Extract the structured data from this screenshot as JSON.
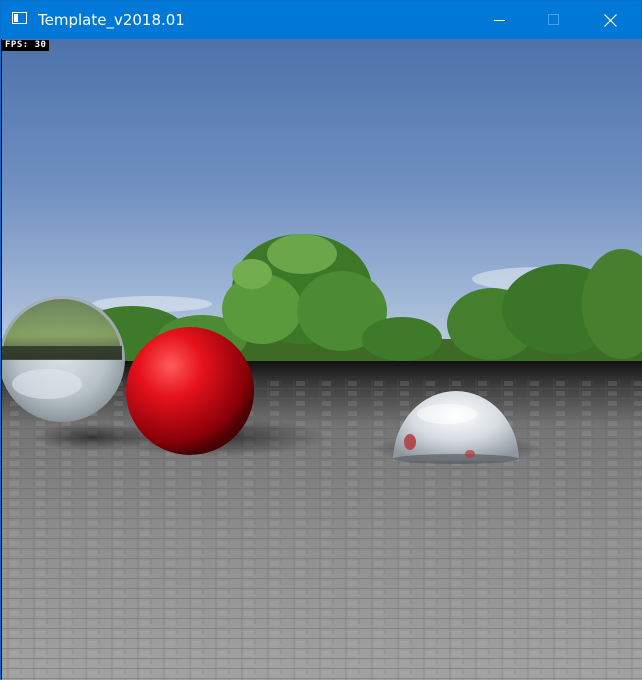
{
  "window": {
    "title": "Template_v2018.01",
    "controls": [
      "minimize",
      "maximize",
      "close"
    ]
  },
  "overlay": {
    "fps_text": "FPS: 30"
  },
  "scene": {
    "objects": [
      {
        "name": "glass-sphere",
        "color": "#c9d3da"
      },
      {
        "name": "red-sphere",
        "color": "#e0101a"
      },
      {
        "name": "chrome-hemisphere",
        "color": "#d8dde2"
      }
    ],
    "sky_color": "#5a7fb4",
    "floor_color": "#8a8a8a"
  },
  "colors": {
    "titlebar": "#0078d7",
    "title_text": "#ffffff"
  }
}
